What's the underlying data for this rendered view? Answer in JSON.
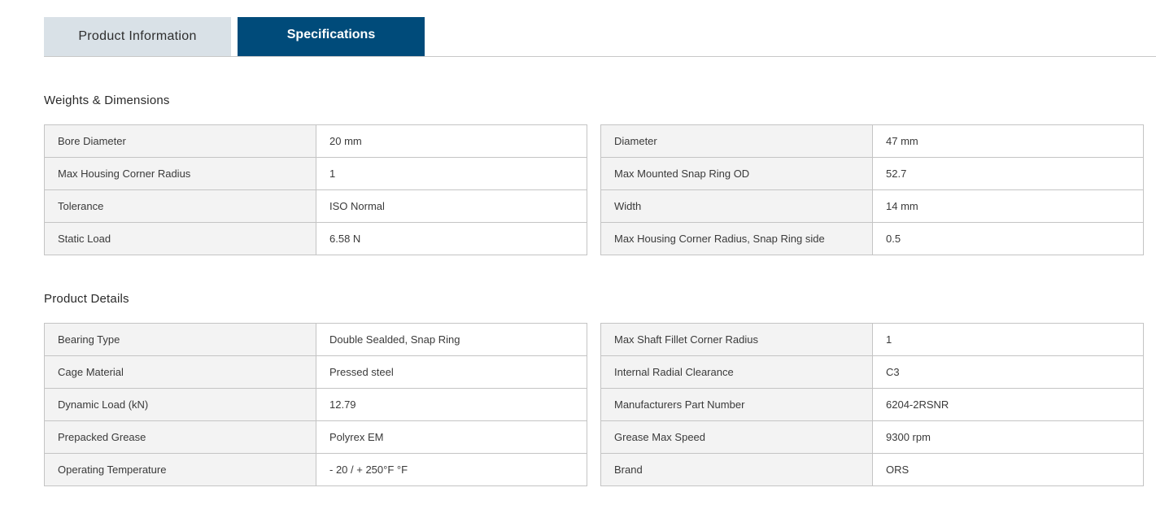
{
  "tabs": {
    "product_information": "Product Information",
    "specifications": "Specifications"
  },
  "colors": {
    "active_tab": "#004b7a",
    "inactive_tab": "#d9e1e7",
    "label_cell": "#f3f3f3"
  },
  "weights": {
    "title": "Weights & Dimensions",
    "left": [
      {
        "label": "Bore Diameter",
        "value": "20 mm"
      },
      {
        "label": "Max Housing Corner Radius",
        "value": "1"
      },
      {
        "label": "Tolerance",
        "value": "ISO Normal"
      },
      {
        "label": "Static Load",
        "value": "6.58 N"
      }
    ],
    "right": [
      {
        "label": "Diameter",
        "value": "47 mm"
      },
      {
        "label": "Max Mounted Snap Ring OD",
        "value": "52.7"
      },
      {
        "label": "Width",
        "value": "14 mm"
      },
      {
        "label": "Max Housing Corner Radius, Snap Ring side",
        "value": "0.5"
      }
    ]
  },
  "details": {
    "title": "Product Details",
    "left": [
      {
        "label": "Bearing Type",
        "value": "Double Sealded, Snap Ring"
      },
      {
        "label": "Cage Material",
        "value": "Pressed steel"
      },
      {
        "label": "Dynamic Load (kN)",
        "value": "12.79"
      },
      {
        "label": "Prepacked Grease",
        "value": "Polyrex EM"
      },
      {
        "label": "Operating Temperature",
        "value": "- 20 / + 250°F °F"
      }
    ],
    "right": [
      {
        "label": "Max Shaft Fillet Corner Radius",
        "value": "1"
      },
      {
        "label": "Internal Radial Clearance",
        "value": "C3"
      },
      {
        "label": "Manufacturers Part Number",
        "value": "6204-2RSNR"
      },
      {
        "label": "Grease Max Speed",
        "value": "9300 rpm"
      },
      {
        "label": "Brand",
        "value": "ORS"
      }
    ]
  }
}
